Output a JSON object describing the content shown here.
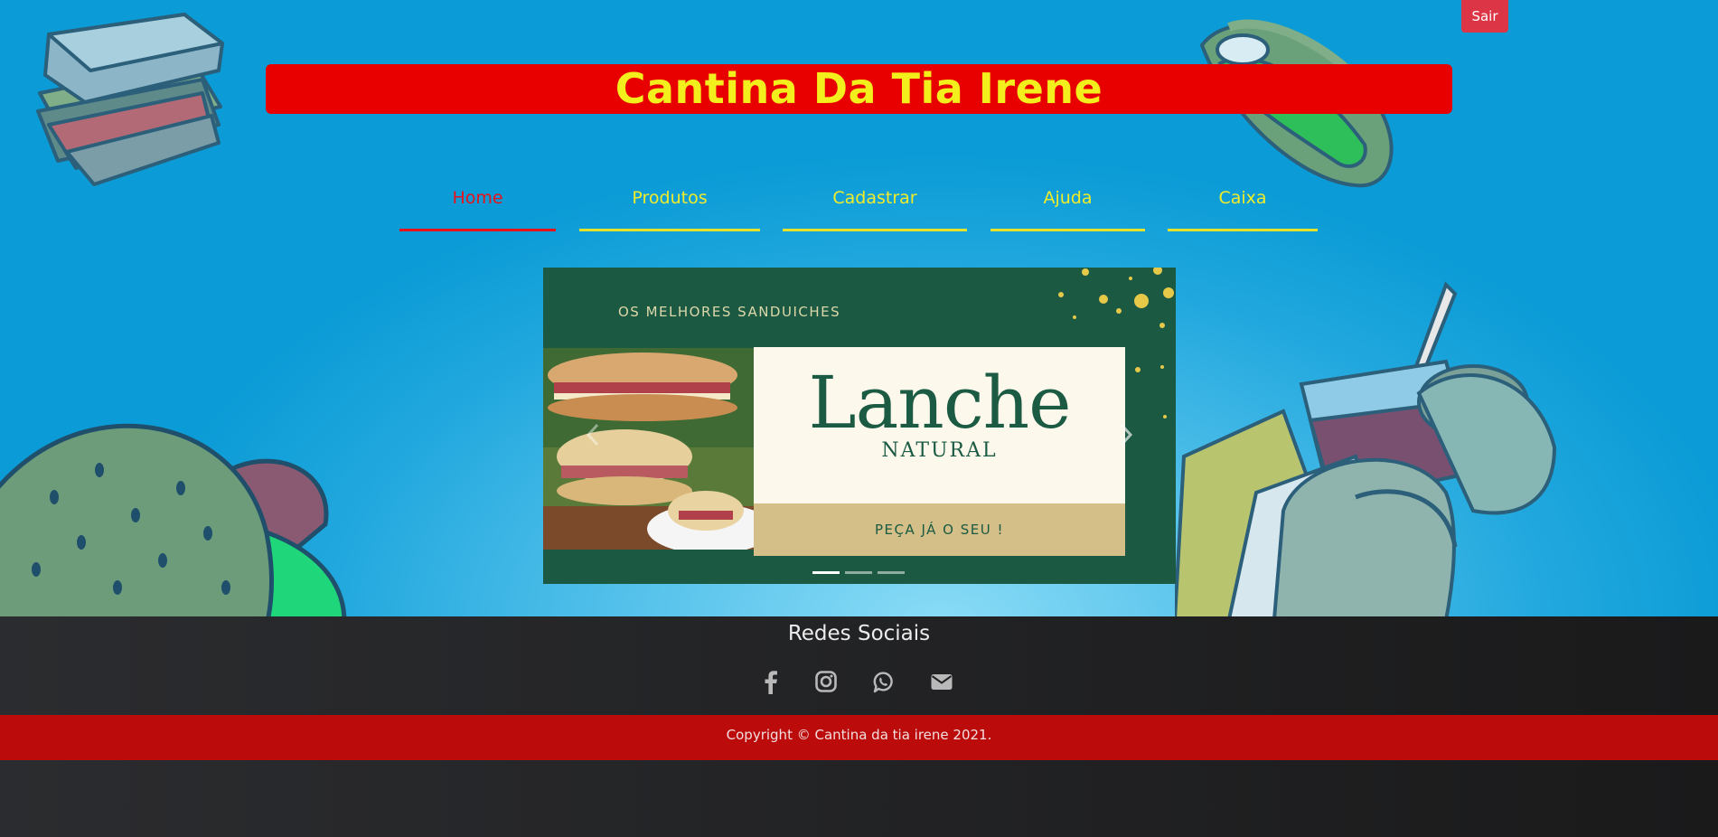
{
  "header": {
    "logout_label": "Sair",
    "site_title": "Cantina Da Tia Irene"
  },
  "nav": {
    "items": [
      {
        "label": "Home",
        "active": true
      },
      {
        "label": "Produtos",
        "active": false
      },
      {
        "label": "Cadastrar",
        "active": false
      },
      {
        "label": "Ajuda",
        "active": false
      },
      {
        "label": "Caixa",
        "active": false
      }
    ]
  },
  "carousel": {
    "tagline": "OS MELHORES SANDUICHES",
    "headline": "Lanche",
    "subheadline": "NATURAL",
    "cta": "PEÇA JÁ O SEU !",
    "slide_count": 3,
    "active_slide": 1
  },
  "footer": {
    "social_title": "Redes Sociais",
    "social_icons": [
      "facebook-icon",
      "instagram-icon",
      "whatsapp-icon",
      "envelope-icon"
    ],
    "copyright": "Copyright © Cantina da tia irene 2021."
  },
  "colors": {
    "title_bar": "#e80000",
    "title_text": "#f3ef1c",
    "nav_text": "#f1ec2a",
    "nav_active": "#e8131a",
    "carousel_bg": "#1c5942",
    "logout_button": "#dc3545",
    "copyright_bar": "#bb0b0b"
  }
}
